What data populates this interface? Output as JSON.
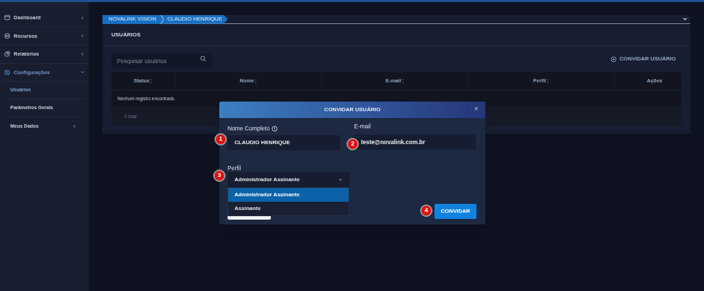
{
  "sidebar": {
    "items": [
      {
        "label": "Dashboard",
        "expanded": false,
        "selected": false
      },
      {
        "label": "Recursos",
        "expanded": false,
        "selected": false
      },
      {
        "label": "Relatórios",
        "expanded": false,
        "selected": false
      },
      {
        "label": "Configurações",
        "expanded": true,
        "selected": true,
        "children": [
          {
            "label": "Usuários",
            "selected": true,
            "has_children": false
          },
          {
            "label": "Parâmetros Gerais",
            "selected": false,
            "has_children": false
          },
          {
            "label": "Meus Dados",
            "selected": false,
            "has_children": true
          }
        ]
      }
    ]
  },
  "breadcrumb": [
    "NOVALINK VISION",
    "CLAUDIO HENRIQUE"
  ],
  "page": {
    "title": "USUÁRIOS",
    "search": {
      "placeholder": "Pesquisar usuários"
    },
    "invite_button": "CONVIDAR USUÁRIO"
  },
  "table": {
    "columns": [
      "Status",
      "Nome",
      "E-mail",
      "Perfil",
      "Ações"
    ],
    "empty_text": "Nenhum registro encontrado.",
    "total": "0 total"
  },
  "modal": {
    "title": "CONVIDAR USUÁRIO",
    "close": "×",
    "name_field": {
      "label": "Nome Completo",
      "value": "CLAUDIO HENRIQUE",
      "marker": "1"
    },
    "email_field": {
      "label": "E-mail",
      "value": "teste@novalink.com.br",
      "marker": "2"
    },
    "profile_field": {
      "label": "Perfil",
      "value": "Administrador Assinante",
      "marker": "3",
      "expanded": true,
      "options": [
        {
          "label": "Administrador Assinante",
          "selected": true
        },
        {
          "label": "Assinante",
          "selected": false
        }
      ]
    },
    "submit": {
      "label": "CONVIDAR",
      "marker": "4"
    }
  }
}
